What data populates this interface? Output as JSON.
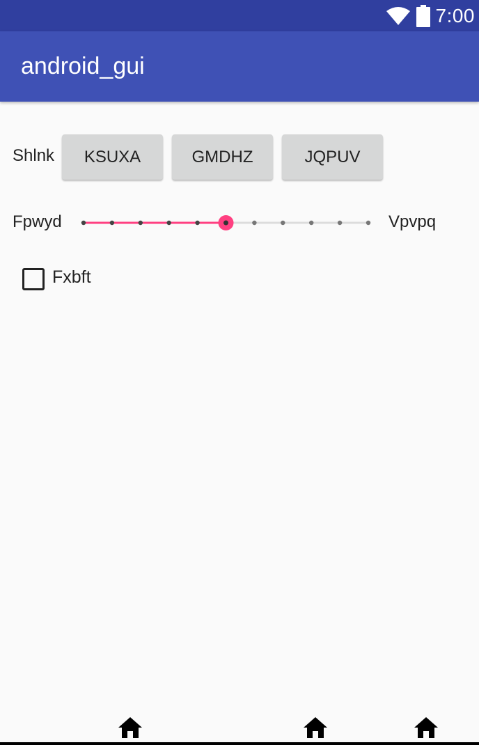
{
  "status_bar": {
    "time": "7:00",
    "icons": [
      "wifi-icon",
      "battery-icon"
    ]
  },
  "app_bar": {
    "title": "android_gui"
  },
  "button_row": {
    "label": "Shlnk",
    "buttons": [
      "KSUXA",
      "GMDHZ",
      "JQPUV"
    ]
  },
  "slider_row": {
    "min_label": "Fpwyd",
    "max_label": "Vpvpq",
    "steps": 10,
    "value": 5
  },
  "checkbox": {
    "label": "Fxbft",
    "checked": false
  },
  "nav_bar": {
    "icons": [
      "home-icon",
      "home-icon",
      "home-icon"
    ]
  },
  "colors": {
    "status_bar": "#303f9f",
    "app_bar": "#3f51b5",
    "accent": "#ff4081",
    "background": "#fafafa",
    "button": "#d6d7d7"
  }
}
